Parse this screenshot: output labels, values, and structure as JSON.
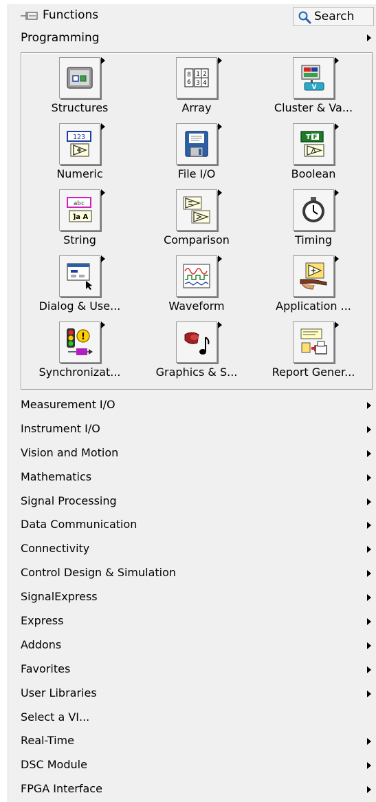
{
  "titlebar": {
    "title": "Functions",
    "search_label": "Search"
  },
  "programming": {
    "label": "Programming"
  },
  "tiles": [
    {
      "label": "Structures",
      "icon": "structures-icon"
    },
    {
      "label": "Array",
      "icon": "array-icon"
    },
    {
      "label": "Cluster & Va...",
      "icon": "cluster-icon"
    },
    {
      "label": "Numeric",
      "icon": "numeric-icon"
    },
    {
      "label": "File I/O",
      "icon": "floppy-disk-icon"
    },
    {
      "label": "Boolean",
      "icon": "boolean-icon"
    },
    {
      "label": "String",
      "icon": "string-icon"
    },
    {
      "label": "Comparison",
      "icon": "comparison-icon"
    },
    {
      "label": "Timing",
      "icon": "stopwatch-icon"
    },
    {
      "label": "Dialog & Use...",
      "icon": "dialog-icon"
    },
    {
      "label": "Waveform",
      "icon": "waveform-icon"
    },
    {
      "label": "Application ...",
      "icon": "application-control-icon"
    },
    {
      "label": "Synchronizat...",
      "icon": "traffic-light-icon"
    },
    {
      "label": "Graphics & S...",
      "icon": "graphics-sound-icon"
    },
    {
      "label": "Report Gener...",
      "icon": "report-printer-icon"
    }
  ],
  "menu": [
    {
      "label": "Measurement I/O",
      "submenu": true
    },
    {
      "label": "Instrument I/O",
      "submenu": true
    },
    {
      "label": "Vision and Motion",
      "submenu": true
    },
    {
      "label": "Mathematics",
      "submenu": true
    },
    {
      "label": "Signal Processing",
      "submenu": true
    },
    {
      "label": "Data Communication",
      "submenu": true
    },
    {
      "label": "Connectivity",
      "submenu": true
    },
    {
      "label": "Control Design & Simulation",
      "submenu": true
    },
    {
      "label": "SignalExpress",
      "submenu": true
    },
    {
      "label": "Express",
      "submenu": true
    },
    {
      "label": "Addons",
      "submenu": true
    },
    {
      "label": "Favorites",
      "submenu": true
    },
    {
      "label": "User Libraries",
      "submenu": true
    },
    {
      "label": "Select a VI...",
      "submenu": false
    },
    {
      "label": "Real-Time",
      "submenu": true
    },
    {
      "label": "DSC Module",
      "submenu": true
    },
    {
      "label": "FPGA Interface",
      "submenu": true
    }
  ]
}
